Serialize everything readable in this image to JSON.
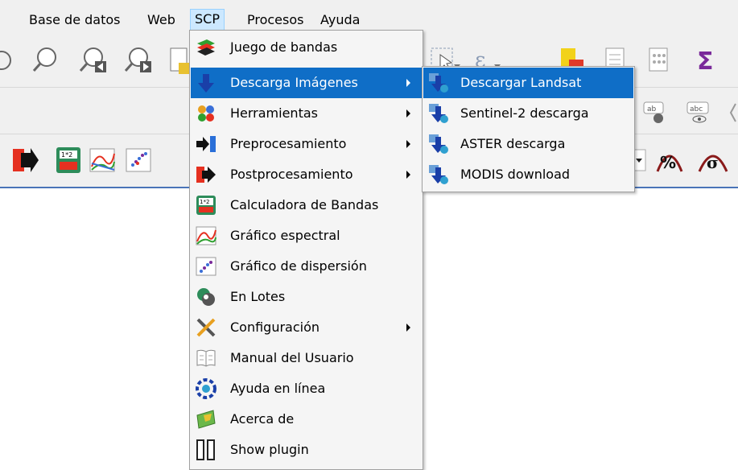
{
  "menubar": {
    "items": [
      {
        "label": "Base de datos"
      },
      {
        "label": "Web"
      },
      {
        "label": "SCP"
      },
      {
        "label": "Procesos"
      },
      {
        "label": "Ayuda"
      }
    ]
  },
  "scp_menu": {
    "items": [
      {
        "label": "Juego de bandas",
        "icon": "band-set-icon"
      },
      {
        "label": "Descarga Imágenes",
        "icon": "download-arrow-icon",
        "submenu": true,
        "highlighted": true
      },
      {
        "label": "Herramientas",
        "icon": "tools-icon",
        "submenu": true
      },
      {
        "label": "Preprocesamiento",
        "icon": "preprocessing-icon",
        "submenu": true
      },
      {
        "label": "Postprocesamiento",
        "icon": "postprocessing-icon",
        "submenu": true
      },
      {
        "label": "Calculadora de Bandas",
        "icon": "band-calc-icon"
      },
      {
        "label": "Gráfico espectral",
        "icon": "spectral-plot-icon"
      },
      {
        "label": "Gráfico de dispersión",
        "icon": "scatter-plot-icon"
      },
      {
        "label": "En Lotes",
        "icon": "batch-icon"
      },
      {
        "label": "Configuración",
        "icon": "settings-icon",
        "submenu": true
      },
      {
        "label": "Manual del Usuario",
        "icon": "manual-icon"
      },
      {
        "label": "Ayuda en línea",
        "icon": "online-help-icon"
      },
      {
        "label": "Acerca de",
        "icon": "about-icon"
      },
      {
        "label": "Show plugin",
        "icon": "show-plugin-icon"
      }
    ]
  },
  "download_submenu": {
    "items": [
      {
        "label": "Descargar Landsat",
        "icon": "landsat-download-icon",
        "highlighted": true
      },
      {
        "label": "Sentinel-2 descarga",
        "icon": "sentinel-download-icon"
      },
      {
        "label": "ASTER descarga",
        "icon": "aster-download-icon"
      },
      {
        "label": "MODIS download",
        "icon": "modis-download-icon"
      }
    ]
  },
  "colors": {
    "highlight": "#0f6ec7",
    "menu_bg": "#f5f5f5",
    "toolbar_bg": "#f0f0f0",
    "menubar_active": "#cce8ff"
  }
}
